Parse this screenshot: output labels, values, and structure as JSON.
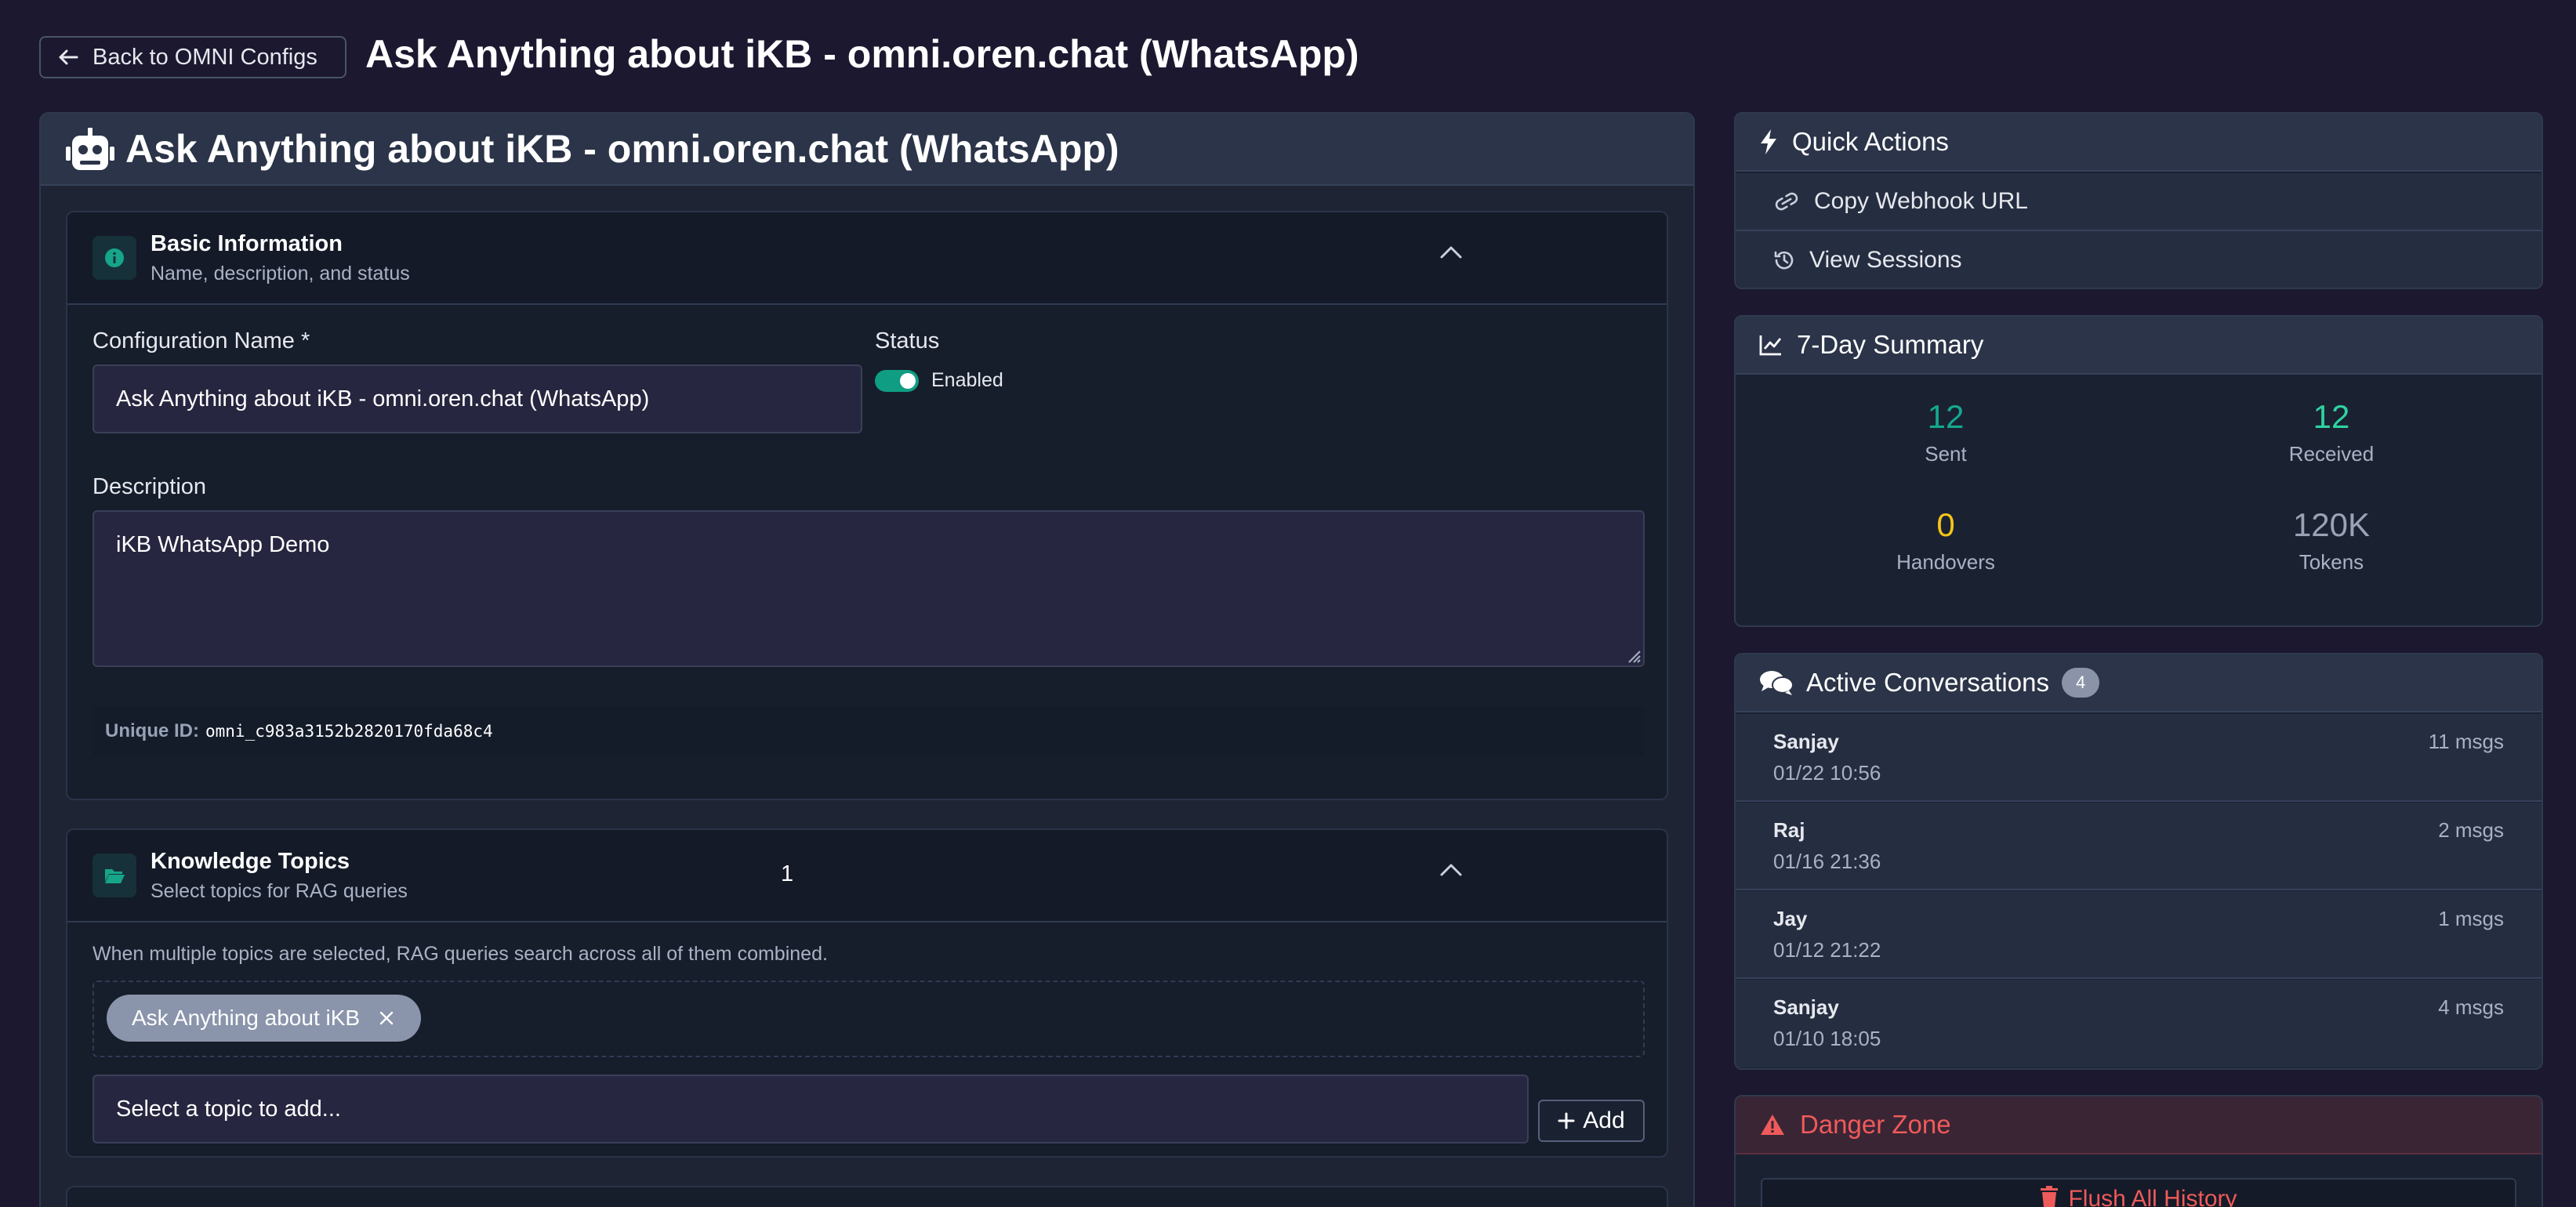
{
  "header": {
    "back_label": "Back to OMNI Configs",
    "page_title": "Ask Anything about iKB - omni.oren.chat (WhatsApp)"
  },
  "main": {
    "title": "Ask Anything about iKB - omni.oren.chat (WhatsApp)",
    "basic": {
      "title": "Basic Information",
      "subtitle": "Name, description, and status",
      "config_name_label": "Configuration Name *",
      "config_name_value": "Ask Anything about iKB - omni.oren.chat (WhatsApp)",
      "status_label": "Status",
      "status_value": "Enabled",
      "description_label": "Description",
      "description_value": "iKB WhatsApp Demo",
      "unique_id_label": "Unique ID:",
      "unique_id_value": "omni_c983a3152b2820170fda68c4"
    },
    "topics": {
      "title": "Knowledge Topics",
      "subtitle": "Select topics for RAG queries",
      "count": "1",
      "help": "When multiple topics are selected, RAG queries search across all of them combined.",
      "chips": [
        "Ask Anything about iKB"
      ],
      "select_placeholder": "Select a topic to add...",
      "add_label": "Add"
    }
  },
  "quick_actions": {
    "title": "Quick Actions",
    "items": [
      {
        "label": "Copy Webhook URL",
        "icon": "link-icon"
      },
      {
        "label": "View Sessions",
        "icon": "history-icon"
      }
    ]
  },
  "summary": {
    "title": "7-Day Summary",
    "stats": [
      {
        "value": "12",
        "label": "Sent",
        "color": "#14a88e"
      },
      {
        "value": "12",
        "label": "Received",
        "color": "#2ed3a0"
      },
      {
        "value": "0",
        "label": "Handovers",
        "color": "#f5c518"
      },
      {
        "value": "120K",
        "label": "Tokens",
        "color": "#9aa3b5"
      }
    ]
  },
  "conversations": {
    "title": "Active Conversations",
    "badge": "4",
    "items": [
      {
        "name": "Sanjay",
        "date": "01/22 10:56",
        "count": "11 msgs"
      },
      {
        "name": "Raj",
        "date": "01/16 21:36",
        "count": "2 msgs"
      },
      {
        "name": "Jay",
        "date": "01/12 21:22",
        "count": "1 msgs"
      },
      {
        "name": "Sanjay",
        "date": "01/10 18:05",
        "count": "4 msgs"
      }
    ]
  },
  "danger": {
    "title": "Danger Zone",
    "flush_label": "Flush All History",
    "color": "#ef5a5a"
  },
  "colors": {
    "background": "#1b1830",
    "accent": "#0f9d84"
  }
}
